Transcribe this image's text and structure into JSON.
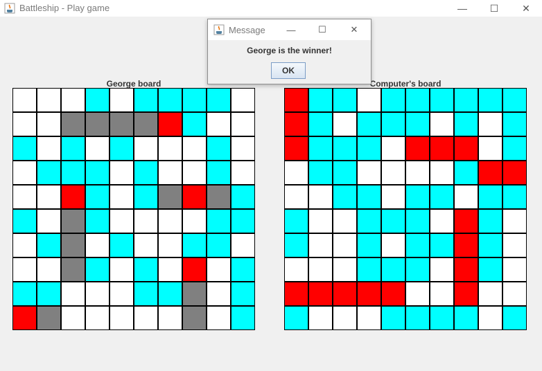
{
  "window": {
    "title": "Battleship - Play game",
    "minimize_glyph": "—",
    "maximize_glyph": "☐",
    "close_glyph": "✕"
  },
  "dialog": {
    "title": "Message",
    "message": "George is the winner!",
    "ok_label": "OK",
    "minimize_glyph": "—",
    "maximize_glyph": "☐",
    "close_glyph": "✕"
  },
  "legend_colors": {
    "w": "#ffffff",
    "c": "#00ffff",
    "r": "#ff0000",
    "g": "#808080"
  },
  "boards": {
    "player": {
      "label": "George board",
      "rows": [
        "wwwcwccccw",
        "wwggggrcww",
        "cwcwcwwwcw",
        "wcccwcwwcw",
        "wwrcwcgrgc",
        "cwgcwwwwcc",
        "wcgwcwwccw",
        "wwgcwcwrwc",
        "ccwwwccgwc",
        "rgwwwwwgwc"
      ]
    },
    "computer": {
      "label": "Computer's board",
      "rows": [
        "rccwcccccc",
        "rcwcccwcwc",
        "rcccwrrrwc",
        "wccwwwwcrr",
        "wwccwccwcc",
        "cwwcccwrcw",
        "cwwcwccrcw",
        "wwwcccwrcw",
        "rrrrrwwrww",
        "cwwwccccwc"
      ]
    }
  }
}
